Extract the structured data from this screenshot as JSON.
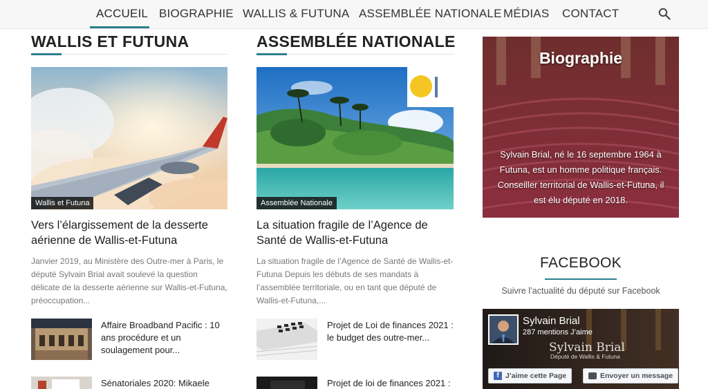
{
  "nav": {
    "items": [
      {
        "label": "ACCUEIL"
      },
      {
        "label": "BIOGRAPHIE"
      },
      {
        "label": "WALLIS & FUTUNA"
      },
      {
        "label": "ASSEMBLÉE NATIONALE"
      },
      {
        "label": "MÉDIAS"
      },
      {
        "label": "CONTACT"
      }
    ],
    "search_icon": "search-icon",
    "accent_color": "#2c7f8e"
  },
  "sections": [
    {
      "title": "WALLIS ET FUTUNA",
      "feature": {
        "badge": "Wallis et Futuna",
        "title": "Vers l’élargissement de la desserte aérienne de Wallis-et-Futuna",
        "excerpt": "Janvier 2019, au Ministère des Outre-mer à Paris, le député Sylvain Brial avait soulevé la question délicate de la desserte aérienne sur Wallis-et-Futuna, préoccupation..."
      },
      "list": [
        {
          "title": "Affaire Broadband Pacific : 10 ans procédure et un soulagement pour..."
        },
        {
          "title": "Sénatoriales 2020: Mikaele"
        }
      ]
    },
    {
      "title": "ASSEMBLÉE NATIONALE",
      "feature": {
        "badge": "Assemblée Nationale",
        "title": "La situation fragile de l’Agence de Santé de Wallis-et-Futuna",
        "excerpt": "La situation fragile de l’Agence de Santé de Wallis-et-Futuna Depuis les débuts de ses mandats à l’assemblée territoriale, ou en tant que député de Wallis-et-Futuna,..."
      },
      "list": [
        {
          "title": "Projet de Loi de finances 2021 : le budget des outre-mer..."
        },
        {
          "title": "Projet de loi de finances 2021 :"
        }
      ]
    }
  ],
  "sidebar": {
    "bio": {
      "title": "Biographie",
      "text": "Sylvain Brial, né le 16 septembre 1964 à Futuna, est un homme politique français. Conseiller territorial de Wallis-et-Futuna, il est élu député en 2018."
    },
    "facebook": {
      "heading": "FACEBOOK",
      "subtitle": "Suivre l’actualité du député sur Facebook",
      "page_name": "Sylvain Brial",
      "likes": "287 mentions J’aime",
      "cover_name": "Sylvain Brial",
      "cover_sub": "Député de Wallis & Futuna",
      "like_button": "J’aime cette Page",
      "message_button": "Envoyer un message"
    }
  }
}
